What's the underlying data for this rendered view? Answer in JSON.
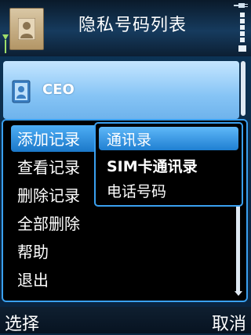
{
  "header": {
    "title": "隐私号码列表",
    "contact_icon": "contact-card-icon",
    "signal_icon": "antenna-icon",
    "battery_icon": "battery-icon",
    "charging_icon": "plug-icon"
  },
  "list": {
    "items": [
      {
        "label": "CEO",
        "icon": "contact-icon"
      }
    ]
  },
  "menu": {
    "items": [
      {
        "label": "添加记录"
      },
      {
        "label": "查看记录"
      },
      {
        "label": "删除记录"
      },
      {
        "label": "全部删除"
      },
      {
        "label": "帮助"
      },
      {
        "label": "退出"
      }
    ]
  },
  "submenu": {
    "items": [
      {
        "label": "通讯录"
      },
      {
        "label": "SIM卡通讯录"
      },
      {
        "label": "电话号码"
      }
    ]
  },
  "softkeys": {
    "left": "选择",
    "right": "取消"
  },
  "colors": {
    "accent": "#3aa0f0",
    "highlight": "#1f7fd2",
    "background": "#0b2a44"
  }
}
